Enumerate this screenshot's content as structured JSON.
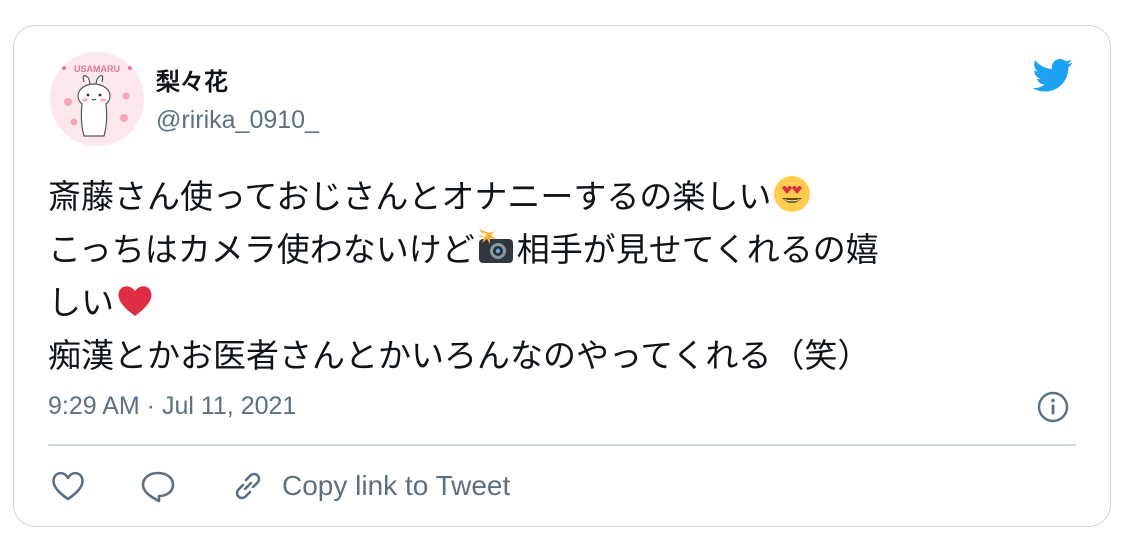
{
  "user": {
    "display_name": "梨々花",
    "handle": "@ririka_0910_",
    "avatar_icon": "usamaru-avatar-icon",
    "avatar_text": "USAMARU"
  },
  "tweet": {
    "lines": [
      {
        "before": "斎藤さん使っておじさんとオナニーするの楽しい",
        "emoji": "heart-eyes-emoji",
        "after": ""
      },
      {
        "before": "こっちはカメラ使わないけど",
        "emoji": "camera-flash-emoji",
        "after": "相手が見せてくれるの嬉"
      },
      {
        "before": "しい",
        "emoji": "red-heart-emoji",
        "after": ""
      },
      {
        "before": "痴漢とかお医者さんとかいろんなのやってくれる（笑）",
        "emoji": "",
        "after": ""
      }
    ]
  },
  "timestamp": "9:29 AM · Jul 11, 2021",
  "actions": {
    "like_icon": "heart-outline-icon",
    "reply_icon": "speech-bubble-icon",
    "copy_icon": "link-icon",
    "copy_label": "Copy link to Tweet"
  },
  "colors": {
    "brand_blue": "#1da1f2",
    "secondary_text": "#5b7083",
    "border": "#c9d4dd"
  }
}
